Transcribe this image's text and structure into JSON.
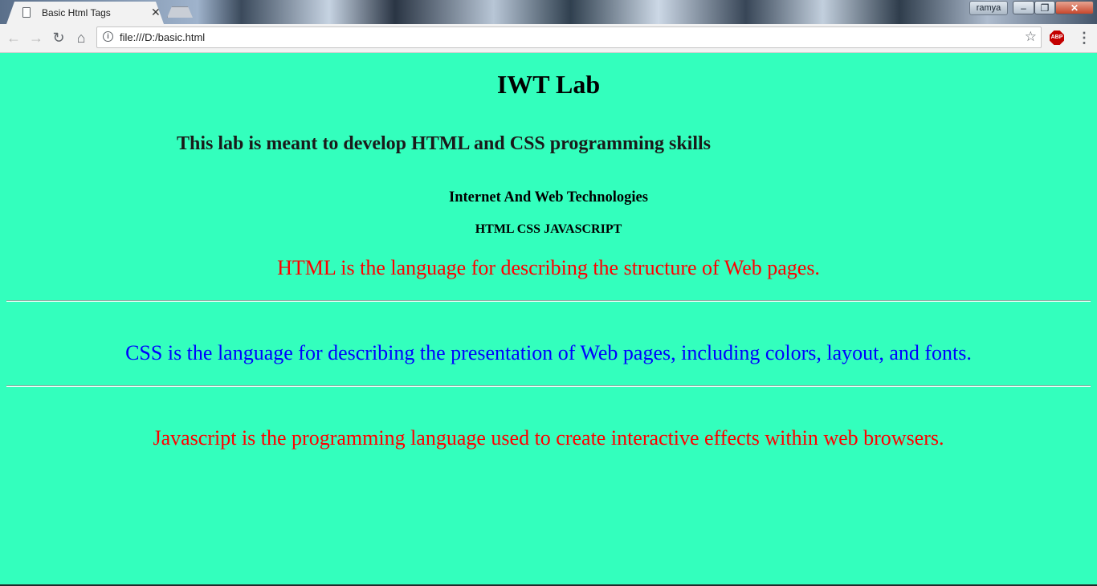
{
  "browser": {
    "tab_title": "Basic Html Tags",
    "tab_close": "✕",
    "user_name": "ramya",
    "url": "file:///D:/basic.html",
    "abp_label": "ABP",
    "icons": {
      "back": "←",
      "forward": "→",
      "reload": "↻",
      "home": "⌂",
      "info": "i",
      "star": "☆",
      "menu": "⋮",
      "minimize": "–",
      "maximize": "❐",
      "close": "✕"
    }
  },
  "page": {
    "background": "#33ffbd",
    "h1": "IWT Lab",
    "h2": "This lab is meant to develop HTML and CSS programming skills",
    "h3": "Internet And Web Technologies",
    "h4": "HTML CSS JAVASCRIPT",
    "paragraphs": [
      {
        "text": "HTML is the language for describing the structure of Web pages.",
        "color": "#ff0000"
      },
      {
        "text": "CSS is the language for describing the presentation of Web pages, including colors, layout, and fonts.",
        "color": "#0000ff"
      },
      {
        "text": "Javascript is the programming language used to create interactive effects within web browsers.",
        "color": "#ff0000"
      }
    ]
  }
}
